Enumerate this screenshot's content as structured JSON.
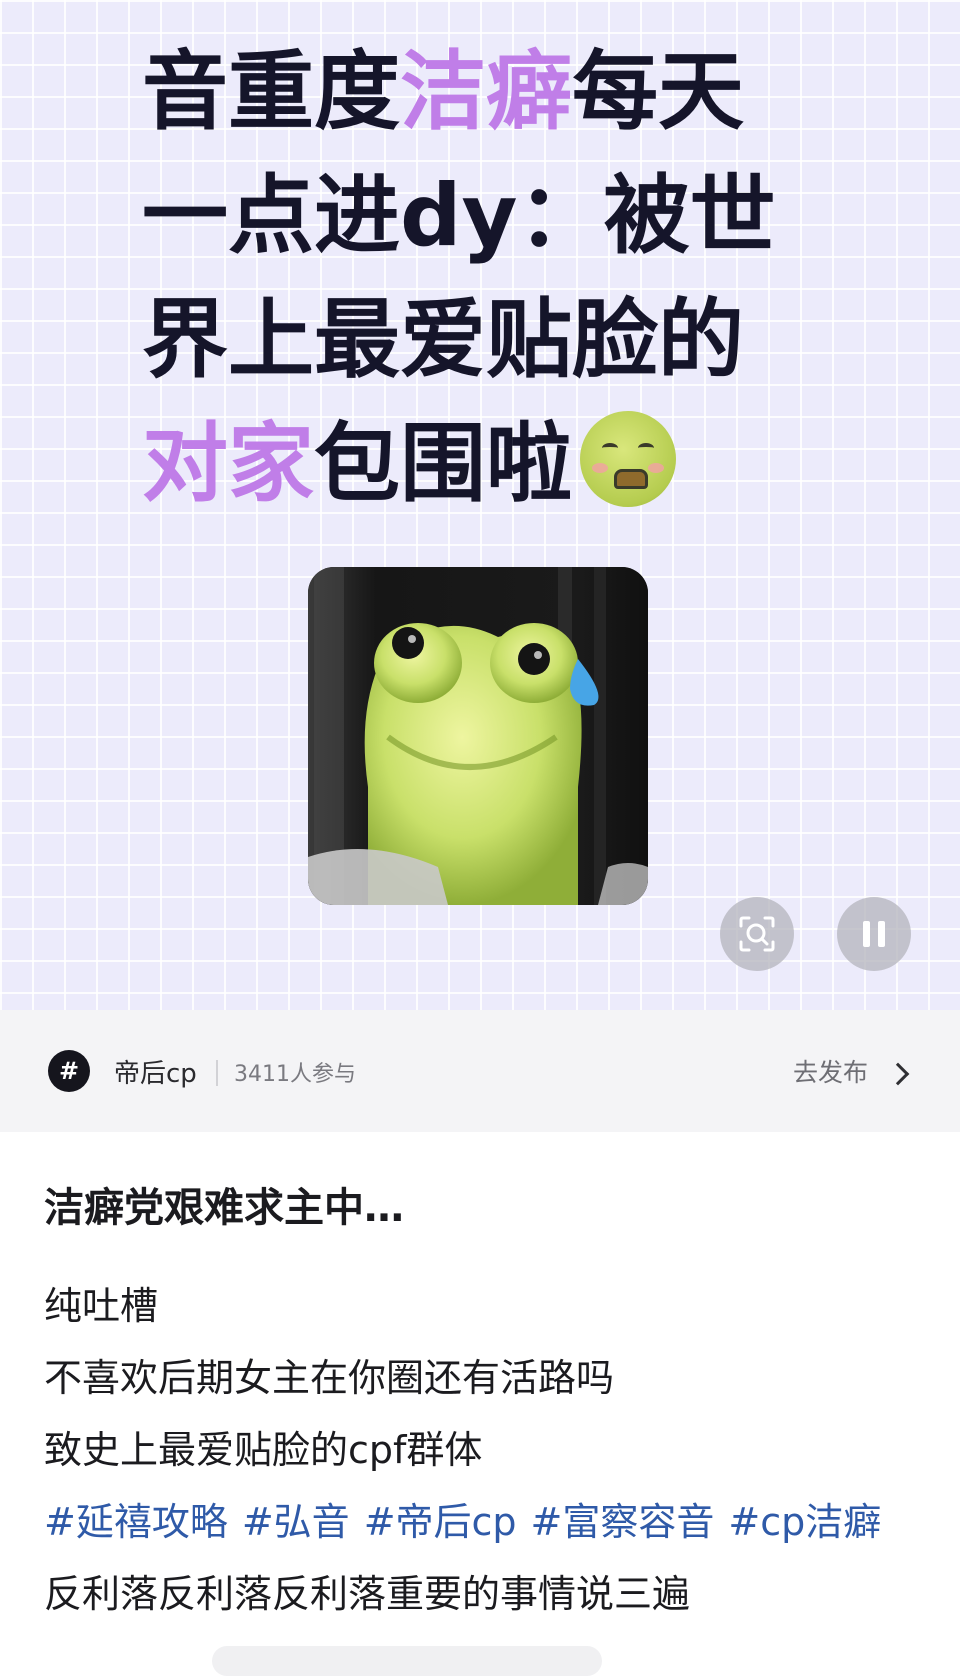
{
  "hero": {
    "title_lines": [
      {
        "parts": [
          {
            "t": "音重度",
            "hl": false
          },
          {
            "t": "洁癖",
            "hl": true
          },
          {
            "t": "每天",
            "hl": false
          }
        ]
      },
      {
        "parts": [
          {
            "t": "一点进dy：被世",
            "hl": false
          }
        ]
      },
      {
        "parts": [
          {
            "t": "界上最爱贴脸的",
            "hl": false
          }
        ]
      },
      {
        "parts": [
          {
            "t": "对家",
            "hl": true
          },
          {
            "t": "包围啦",
            "hl": false
          }
        ],
        "emoji": "nauseated-face-emoji"
      }
    ],
    "highlight_color": "#c07ee8",
    "image_name": "frog-sweat-meme",
    "scan_icon": "image-search-icon",
    "pause_icon": "pause-icon"
  },
  "topic": {
    "icon_glyph": "#",
    "name": "帝后cp",
    "participants": "3411人参与",
    "publish_label": "去发布"
  },
  "post": {
    "title": "洁癖党艰难求主中…",
    "lines": [
      "纯吐槽",
      "不喜欢后期女主在你圈还有活路吗",
      "致史上最爱贴脸的cpf群体"
    ],
    "tags": [
      "#延禧攻略",
      "#弘音",
      "#帝后cp",
      "#富察容音",
      "#cp洁癖"
    ],
    "tag_color": "#2f5aa8",
    "last_line": "反利落反利落反利落重要的事情说三遍"
  }
}
